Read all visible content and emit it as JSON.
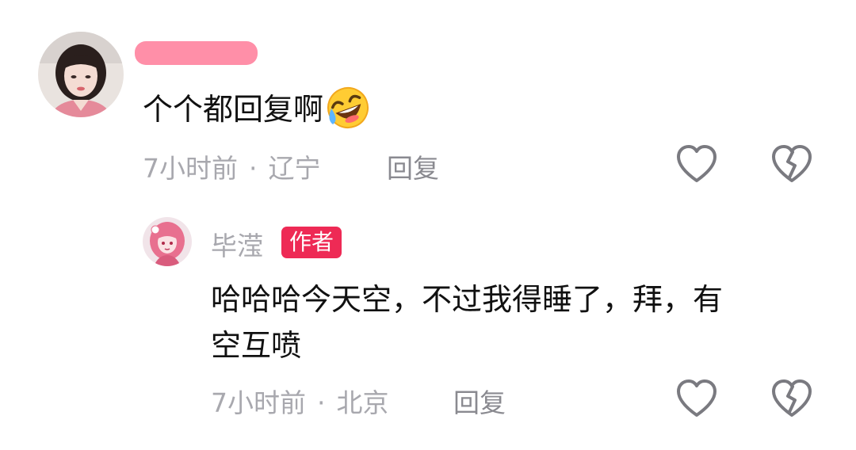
{
  "comment": {
    "text": "个个都回复啊",
    "emoji": "rolling-on-floor-laughing-emoji",
    "time": "7小时前",
    "location": "辽宁",
    "separator": "·",
    "reply_label": "回复",
    "like_icon": "heart-outline-icon",
    "dislike_icon": "broken-heart-icon"
  },
  "reply": {
    "username": "毕滢",
    "badge": "作者",
    "text_line1": "哈哈哈今天空，不过我得睡了，拜，有",
    "text_line2": "空互喷",
    "time": "7小时前",
    "location": "北京",
    "separator": "·",
    "reply_label": "回复",
    "like_icon": "heart-outline-icon",
    "dislike_icon": "broken-heart-icon"
  },
  "colors": {
    "badge": "#ee2a55",
    "meta_text": "#a8a8ae",
    "redacted_name": "#ff8fa8"
  }
}
